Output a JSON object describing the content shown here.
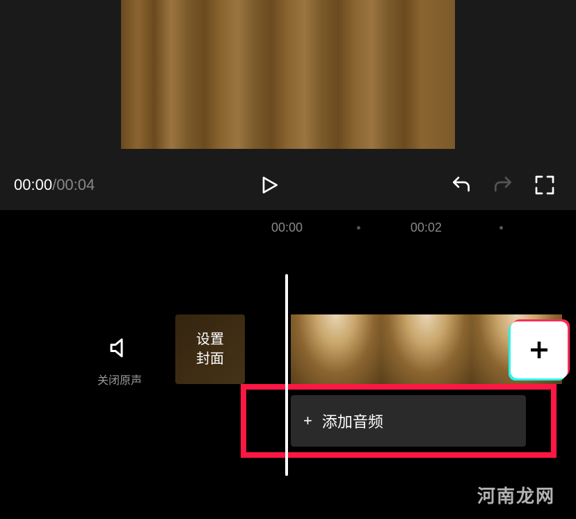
{
  "playback": {
    "current_time": "00:00",
    "separator": "/",
    "total_time": "00:04"
  },
  "ruler": {
    "mark1": "00:00",
    "mark2": "00:02"
  },
  "timeline": {
    "mute_label": "关闭原声",
    "cover_label_line1": "设置",
    "cover_label_line2": "封面",
    "add_audio_label": "添加音频"
  },
  "watermark": "河南龙网"
}
